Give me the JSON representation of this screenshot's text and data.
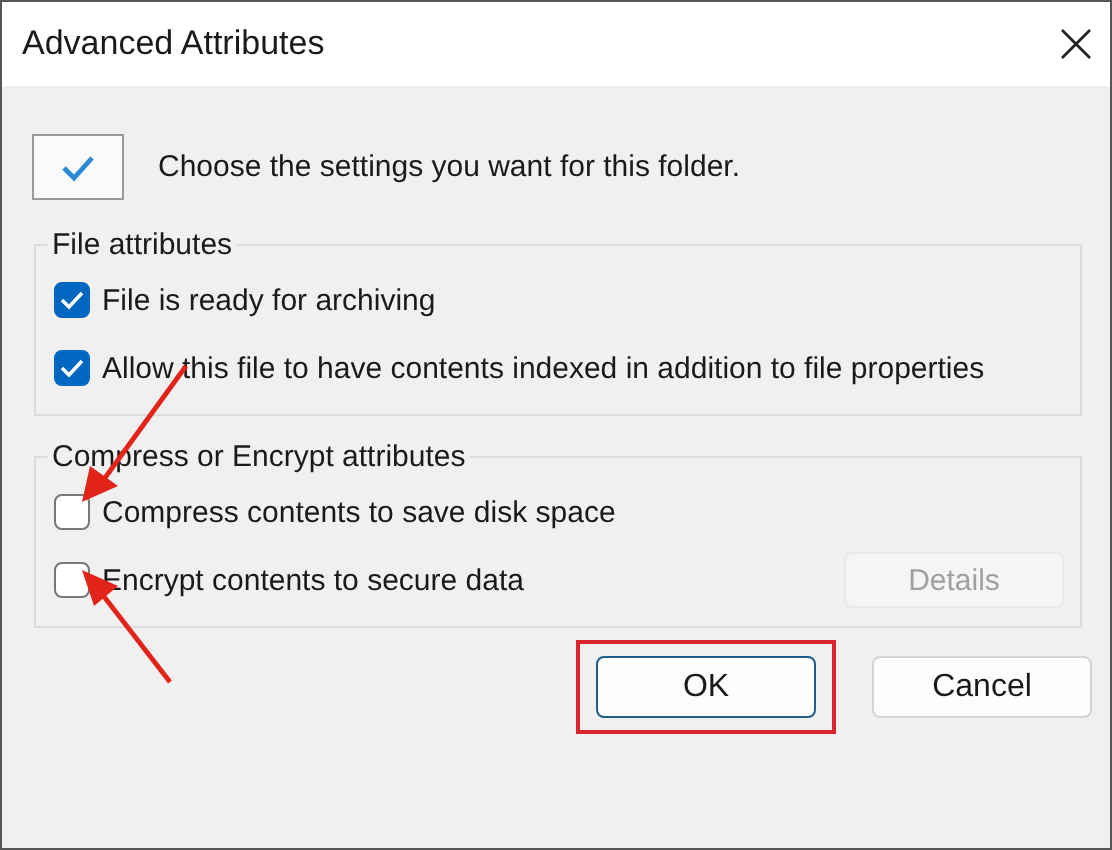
{
  "window": {
    "title": "Advanced Attributes"
  },
  "header": {
    "text": "Choose the settings you want for this folder."
  },
  "groups": [
    {
      "title": "File attributes",
      "options": [
        {
          "label": "File is ready for archiving",
          "checked": true,
          "marked": false
        },
        {
          "label": "Allow this file to have contents indexed in addition to file properties",
          "checked": true,
          "marked": false
        }
      ]
    },
    {
      "title": "Compress or Encrypt attributes",
      "options": [
        {
          "label": "Compress contents to save disk space",
          "checked": false,
          "marked": true
        },
        {
          "label": "Encrypt contents to secure data",
          "checked": false,
          "marked": true
        }
      ],
      "details": {
        "label": "Details",
        "disabled": true
      }
    }
  ],
  "buttons": [
    {
      "label": "OK",
      "default": true,
      "highlighted": true
    },
    {
      "label": "Cancel",
      "default": false,
      "highlighted": false
    }
  ]
}
